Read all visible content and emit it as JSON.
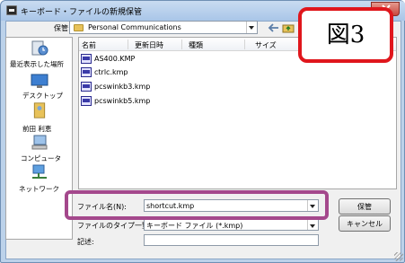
{
  "window": {
    "title": "キーボード・ファイルの新規保管"
  },
  "toolbar": {
    "save_in_label": "保管:",
    "current_folder": "Personal Communications"
  },
  "places": [
    {
      "label": "最近表示した場所",
      "icon": "recent-places-icon"
    },
    {
      "label": "デスクトップ",
      "icon": "desktop-icon"
    },
    {
      "label": "前田 利恵",
      "icon": "user-folder-icon"
    },
    {
      "label": "コンピュータ",
      "icon": "computer-icon"
    },
    {
      "label": "ネットワーク",
      "icon": "network-icon"
    }
  ],
  "columns": {
    "name": "名前",
    "modified": "更新日時",
    "type": "種類",
    "size": "サイズ"
  },
  "files": [
    {
      "name": "AS400.KMP"
    },
    {
      "name": "ctrlc.kmp"
    },
    {
      "name": "pcswinkb3.kmp"
    },
    {
      "name": "pcswinkb5.kmp"
    }
  ],
  "form": {
    "filename_label": "ファイル名(N):",
    "filename_value": "shortcut.kmp",
    "filetype_label": "ファイルのタイプ一覧(T):",
    "filetype_value": "キーボード ファイル (*.kmp)",
    "comment_label": "記述:",
    "comment_value": ""
  },
  "buttons": {
    "save": "保管",
    "cancel": "キャンセル"
  },
  "annotation": {
    "label": "図3"
  },
  "colors": {
    "callout_border": "#e0161c",
    "highlight_border": "#a4488c",
    "close_button": "#c9463d"
  }
}
